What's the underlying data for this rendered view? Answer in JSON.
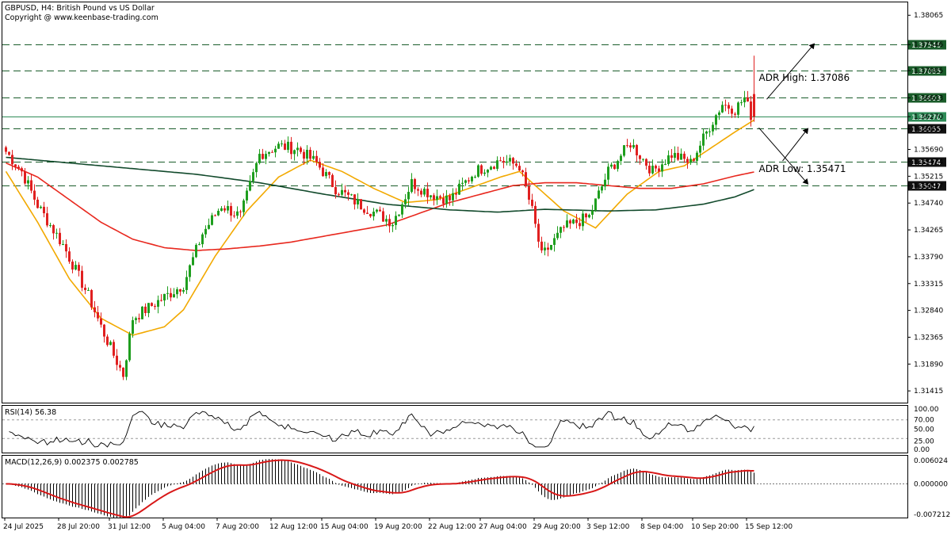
{
  "header": {
    "line1": "GBPUSD, H4:  British Pound vs US Dollar",
    "line2": "Copyright @ www.keenbase-trading.com"
  },
  "colors": {
    "bull": "#1e9e1e",
    "bear": "#e02020",
    "ma_fast": "#f2a900",
    "ma_mid": "#e8281e",
    "ma_slow": "#124a2c",
    "level": "#1a5c2a",
    "macd_signal": "#d81818",
    "rsi": "#000000"
  },
  "chart_data": [
    {
      "type": "candlestick",
      "symbol": "GBPUSD",
      "timeframe": "H4",
      "ylim": [
        1.312,
        1.383
      ],
      "y_ticks": [
        "1.38065",
        "1.37546",
        "1.37085",
        "1.36603",
        "1.36270",
        "1.36055",
        "1.35690",
        "1.35474",
        "1.35215",
        "1.35047",
        "1.34740",
        "1.34265",
        "1.33790",
        "1.33315",
        "1.32840",
        "1.32365",
        "1.31890",
        "1.31415"
      ],
      "x_ticks": [
        "24 Jul 2025",
        "28 Jul 20:00",
        "31 Jul 12:00",
        "5 Aug 04:00",
        "7 Aug 20:00",
        "12 Aug 12:00",
        "15 Aug 04:00",
        "19 Aug 20:00",
        "22 Aug 12:00",
        "27 Aug 04:00",
        "29 Aug 20:00",
        "3 Sep 12:00",
        "8 Sep 04:00",
        "10 Sep 20:00",
        "15 Sep 12:00"
      ],
      "key_points": [
        [
          0,
          1.3565
        ],
        [
          5,
          1.353
        ],
        [
          10,
          1.347
        ],
        [
          18,
          1.34
        ],
        [
          26,
          1.331
        ],
        [
          30,
          1.3255
        ],
        [
          34,
          1.3205
        ],
        [
          37,
          1.317
        ],
        [
          40,
          1.327
        ],
        [
          48,
          1.33
        ],
        [
          56,
          1.333
        ],
        [
          62,
          1.342
        ],
        [
          68,
          1.347
        ],
        [
          74,
          1.345
        ],
        [
          80,
          1.356
        ],
        [
          86,
          1.3575
        ],
        [
          92,
          1.357
        ],
        [
          98,
          1.3545
        ],
        [
          104,
          1.35
        ],
        [
          112,
          1.347
        ],
        [
          122,
          1.344
        ],
        [
          128,
          1.351
        ],
        [
          134,
          1.349
        ],
        [
          140,
          1.348
        ],
        [
          148,
          1.353
        ],
        [
          156,
          1.355
        ],
        [
          162,
          1.354
        ],
        [
          166,
          1.346
        ],
        [
          169,
          1.338
        ],
        [
          172,
          1.34
        ],
        [
          176,
          1.343
        ],
        [
          184,
          1.345
        ],
        [
          190,
          1.353
        ],
        [
          197,
          1.358
        ],
        [
          204,
          1.353
        ],
        [
          210,
          1.356
        ],
        [
          216,
          1.3545
        ],
        [
          222,
          1.361
        ],
        [
          226,
          1.365
        ],
        [
          230,
          1.364
        ],
        [
          233,
          1.366
        ],
        [
          235,
          1.363
        ]
      ],
      "last_bar": {
        "o": 1.3667,
        "h": 1.3735,
        "l": 1.3618,
        "c": 1.3627
      },
      "moving_averages": [
        {
          "color": "#f2a900",
          "key_points": [
            [
              0,
              1.353
            ],
            [
              10,
              1.344
            ],
            [
              20,
              1.334
            ],
            [
              30,
              1.327
            ],
            [
              40,
              1.324
            ],
            [
              50,
              1.3255
            ],
            [
              56,
              1.3285
            ],
            [
              66,
              1.338
            ],
            [
              76,
              1.346
            ],
            [
              86,
              1.352
            ],
            [
              96,
              1.355
            ],
            [
              106,
              1.353
            ],
            [
              116,
              1.35
            ],
            [
              126,
              1.3475
            ],
            [
              136,
              1.348
            ],
            [
              146,
              1.35
            ],
            [
              156,
              1.352
            ],
            [
              162,
              1.353
            ],
            [
              168,
              1.35
            ],
            [
              176,
              1.346
            ],
            [
              186,
              1.343
            ],
            [
              196,
              1.349
            ],
            [
              206,
              1.353
            ],
            [
              214,
              1.354
            ],
            [
              222,
              1.357
            ],
            [
              230,
              1.36
            ],
            [
              236,
              1.3621
            ]
          ]
        },
        {
          "color": "#e8281e",
          "key_points": [
            [
              0,
              1.3545
            ],
            [
              10,
              1.352
            ],
            [
              20,
              1.348
            ],
            [
              30,
              1.344
            ],
            [
              40,
              1.341
            ],
            [
              50,
              1.3395
            ],
            [
              60,
              1.339
            ],
            [
              70,
              1.3393
            ],
            [
              80,
              1.3398
            ],
            [
              90,
              1.3405
            ],
            [
              100,
              1.3415
            ],
            [
              110,
              1.3425
            ],
            [
              120,
              1.3435
            ],
            [
              130,
              1.3455
            ],
            [
              140,
              1.3475
            ],
            [
              150,
              1.349
            ],
            [
              160,
              1.3505
            ],
            [
              170,
              1.351
            ],
            [
              180,
              1.351
            ],
            [
              190,
              1.3505
            ],
            [
              200,
              1.35
            ],
            [
              210,
              1.35
            ],
            [
              220,
              1.3508
            ],
            [
              230,
              1.3522
            ],
            [
              236,
              1.3529
            ]
          ]
        },
        {
          "color": "#124a2c",
          "key_points": [
            [
              0,
              1.3555
            ],
            [
              20,
              1.3545
            ],
            [
              40,
              1.3535
            ],
            [
              60,
              1.3525
            ],
            [
              80,
              1.351
            ],
            [
              100,
              1.349
            ],
            [
              120,
              1.3472
            ],
            [
              140,
              1.3462
            ],
            [
              155,
              1.3458
            ],
            [
              170,
              1.3463
            ],
            [
              190,
              1.346
            ],
            [
              205,
              1.3462
            ],
            [
              220,
              1.3472
            ],
            [
              230,
              1.3485
            ],
            [
              236,
              1.3498
            ]
          ]
        }
      ],
      "levels": [
        {
          "value": 1.37546,
          "label": "1.37546"
        },
        {
          "value": 1.37085,
          "label": "1.37085"
        },
        {
          "value": 1.36603,
          "label": "1.36603"
        },
        {
          "value": 1.36055,
          "label": "1.36055"
        },
        {
          "value": 1.35474,
          "label": "1.35474"
        },
        {
          "value": 1.35047,
          "label": "1.35047"
        }
      ],
      "current_price": {
        "value": 1.3627,
        "label": "1.36270"
      },
      "annotations": {
        "adr_high": {
          "label": "ADR High: 1.37086",
          "value": 1.37086
        },
        "adr_low": {
          "label": "ADR Low: 1.35471",
          "value": 1.35471
        }
      }
    },
    {
      "type": "line",
      "name": "RSI(14)",
      "header": "RSI(14) 56.38",
      "last_value": 56.38,
      "ylim": [
        0,
        100
      ],
      "y_ticks": [
        "100.00",
        "70.00",
        "50.00",
        "25.00",
        "0.00"
      ],
      "levels": [
        70,
        30
      ]
    },
    {
      "type": "bar",
      "name": "MACD(12,26,9)",
      "header": "MACD(12,26,9) 0.002375 0.002785",
      "macd": 0.002375,
      "signal": 0.002785,
      "ylim": [
        -0.0072,
        0.006
      ],
      "y_ticks": [
        "0.006024",
        "0.000000",
        "-0.007212"
      ]
    }
  ]
}
